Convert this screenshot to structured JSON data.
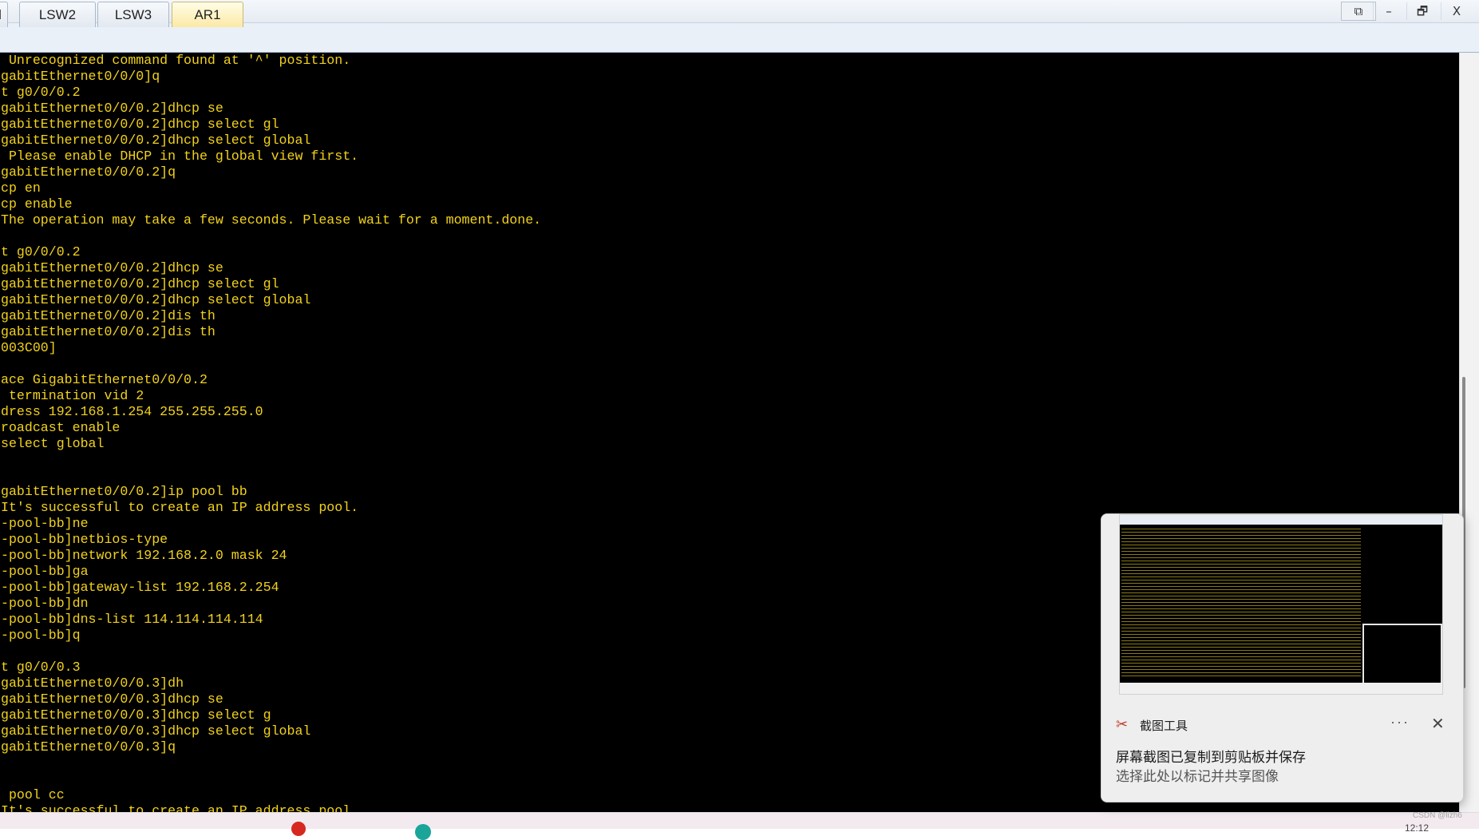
{
  "window": {
    "controls": {
      "restore_small": "⧉",
      "minimize": "–",
      "maximize": "🗗",
      "close": "X"
    }
  },
  "tabs": [
    {
      "label": "l"
    },
    {
      "label": "LSW2"
    },
    {
      "label": "LSW3"
    },
    {
      "label": "AR1",
      "active": true
    }
  ],
  "terminal": {
    "text_color": "#f2d21b",
    "background": "#000000",
    "lines": [
      " Unrecognized command found at '^' position.",
      "gabitEthernet0/0/0]q",
      "t g0/0/0.2",
      "gabitEthernet0/0/0.2]dhcp se",
      "gabitEthernet0/0/0.2]dhcp select gl",
      "gabitEthernet0/0/0.2]dhcp select global",
      " Please enable DHCP in the global view first.",
      "gabitEthernet0/0/0.2]q",
      "cp en",
      "cp enable",
      "The operation may take a few seconds. Please wait for a moment.done.",
      "",
      "t g0/0/0.2",
      "gabitEthernet0/0/0.2]dhcp se",
      "gabitEthernet0/0/0.2]dhcp select gl",
      "gabitEthernet0/0/0.2]dhcp select global",
      "gabitEthernet0/0/0.2]dis th",
      "gabitEthernet0/0/0.2]dis th",
      "003C00]",
      "",
      "ace GigabitEthernet0/0/0.2",
      " termination vid 2",
      "dress 192.168.1.254 255.255.255.0",
      "roadcast enable",
      "select global",
      "",
      "",
      "gabitEthernet0/0/0.2]ip pool bb",
      "It's successful to create an IP address pool.",
      "-pool-bb]ne",
      "-pool-bb]netbios-type",
      "-pool-bb]network 192.168.2.0 mask 24",
      "-pool-bb]ga",
      "-pool-bb]gateway-list 192.168.2.254",
      "-pool-bb]dn",
      "-pool-bb]dns-list 114.114.114.114",
      "-pool-bb]q",
      "",
      "t g0/0/0.3",
      "gabitEthernet0/0/0.3]dh",
      "gabitEthernet0/0/0.3]dhcp se",
      "gabitEthernet0/0/0.3]dhcp select g",
      "gabitEthernet0/0/0.3]dhcp select global",
      "gabitEthernet0/0/0.3]q",
      "",
      "",
      " pool cc",
      "It's successful to create an IP address pool."
    ]
  },
  "notification": {
    "app_icon": "✂",
    "app_name": "截图工具",
    "more": "···",
    "close": "✕",
    "message_line1": "屏幕截图已复制到剪贴板并保存",
    "message_line2": "选择此处以标记并共享图像"
  },
  "taskbar": {
    "clock": "12:12",
    "watermark": "CSDN @lizh6"
  }
}
